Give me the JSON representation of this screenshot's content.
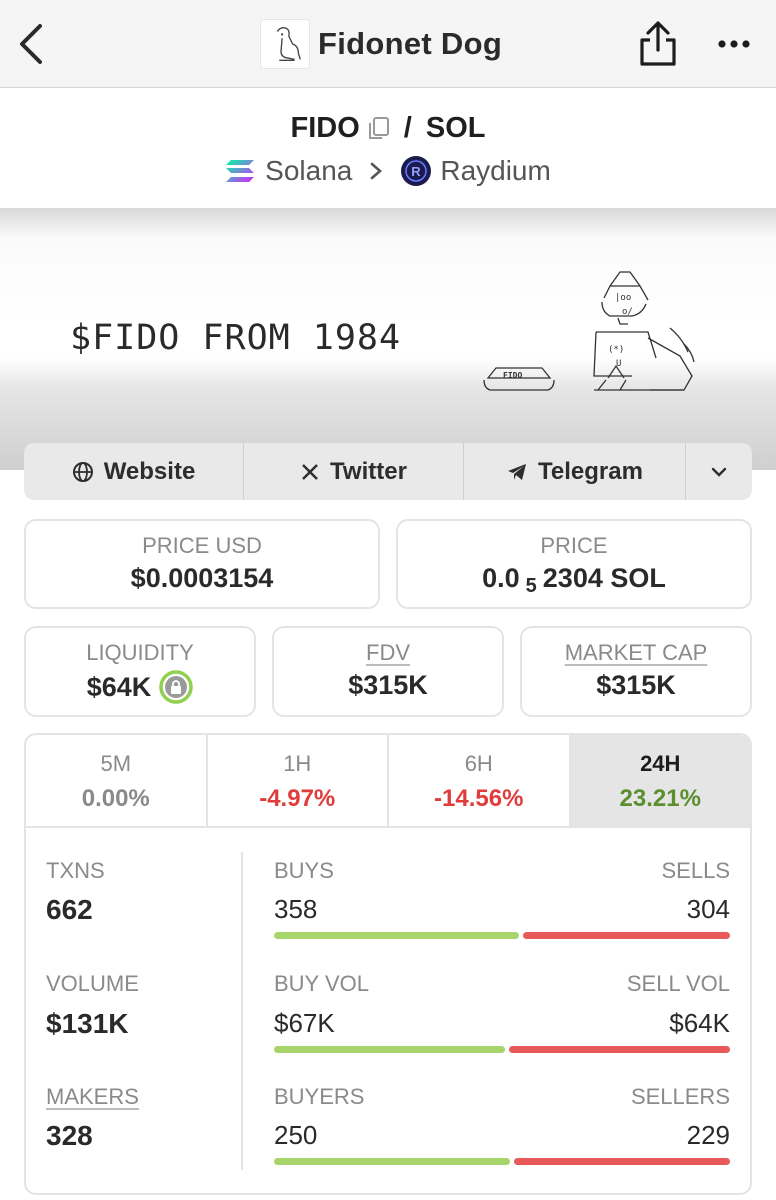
{
  "header": {
    "title": "Fidonet Dog",
    "back_icon": "chevron-left-icon",
    "share_icon": "share-icon",
    "more_icon": "more-horizontal-icon"
  },
  "pair": {
    "base": "FIDO",
    "separator": "/",
    "quote": "SOL",
    "chain": "Solana",
    "dex": "Raydium"
  },
  "banner": {
    "text": "$FIDO FROM 1984",
    "bowl_text": "FIDO"
  },
  "links": [
    {
      "label": "Website",
      "icon": "globe-icon"
    },
    {
      "label": "Twitter",
      "icon": "x-logo-icon"
    },
    {
      "label": "Telegram",
      "icon": "telegram-icon"
    }
  ],
  "price_usd": {
    "label": "PRICE USD",
    "value": "$0.0003154"
  },
  "price_native": {
    "label": "PRICE",
    "prefix": "0.0",
    "zeros": "5",
    "digits": "2304",
    "unit": "SOL"
  },
  "liquidity": {
    "label": "LIQUIDITY",
    "value": "$64K"
  },
  "fdv": {
    "label": "FDV",
    "value": "$315K"
  },
  "market_cap": {
    "label": "MARKET CAP",
    "value": "$315K"
  },
  "timeframes": [
    {
      "label": "5M",
      "change": "0.00%"
    },
    {
      "label": "1H",
      "change": "-4.97%"
    },
    {
      "label": "6H",
      "change": "-14.56%"
    },
    {
      "label": "24H",
      "change": "23.21%"
    }
  ],
  "active_timeframe": "24H",
  "stats": {
    "txns": {
      "label": "TXNS",
      "value": "662"
    },
    "volume": {
      "label": "VOLUME",
      "value": "$131K"
    },
    "makers": {
      "label": "MAKERS",
      "value": "328"
    },
    "buys": {
      "label": "BUYS",
      "value": "358",
      "share": 0.541
    },
    "sells": {
      "label": "SELLS",
      "value": "304"
    },
    "buy_vol": {
      "label": "BUY VOL",
      "value": "$67K",
      "share": 0.511
    },
    "sell_vol": {
      "label": "SELL VOL",
      "value": "$64K"
    },
    "buyers": {
      "label": "BUYERS",
      "value": "250",
      "share": 0.522
    },
    "sellers": {
      "label": "SELLERS",
      "value": "229"
    }
  },
  "colors": {
    "positive": "#5b8f2e",
    "negative": "#e03c3c",
    "neutral": "#8a8a8a",
    "buy_bar": "#a8d56b",
    "sell_bar": "#e85a5a"
  }
}
